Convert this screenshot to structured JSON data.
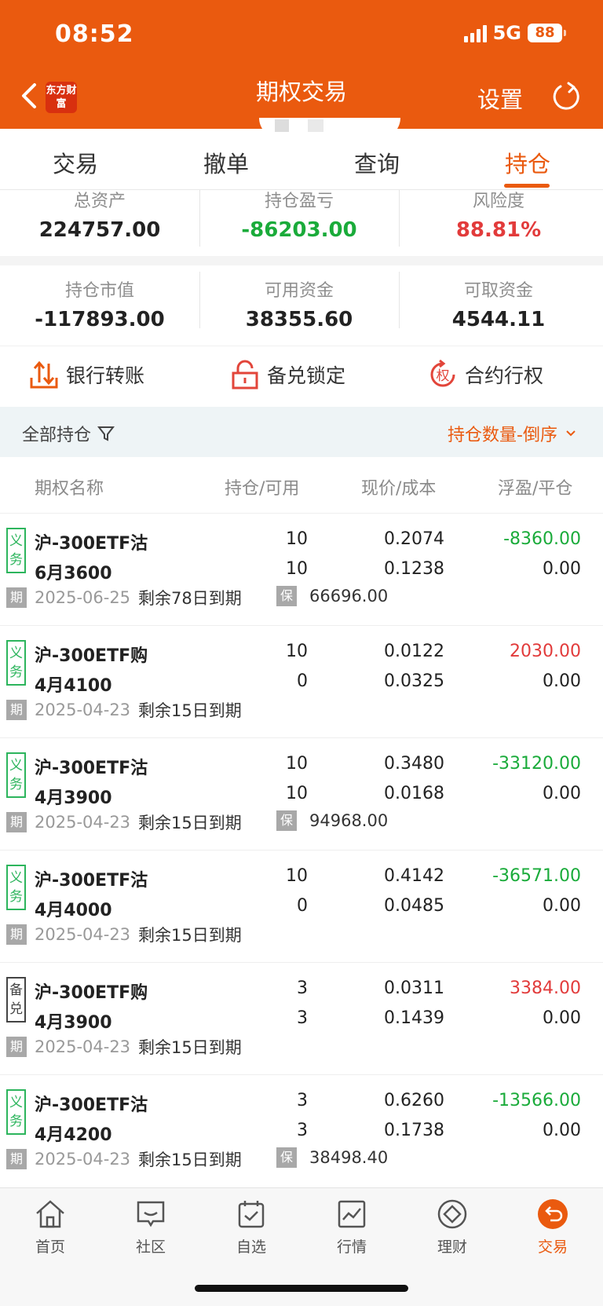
{
  "status_bar": {
    "time": "08:52",
    "network": "5G",
    "battery": "88"
  },
  "header": {
    "title": "期权交易",
    "settings_label": "设置",
    "logo_text": "东方财富"
  },
  "tabs": [
    {
      "label": "交易"
    },
    {
      "label": "撤单"
    },
    {
      "label": "查询"
    },
    {
      "label": "持仓"
    }
  ],
  "summary": {
    "total_assets_label": "总资产",
    "total_assets": "224757.00",
    "position_pl_label": "持仓盈亏",
    "position_pl": "-86203.00",
    "risk_label": "风险度",
    "risk": "88.81%",
    "market_value_label": "持仓市值",
    "market_value": "-117893.00",
    "available_label": "可用资金",
    "available": "38355.60",
    "withdrawable_label": "可取资金",
    "withdrawable": "4544.11"
  },
  "actions": {
    "bank_transfer": "银行转账",
    "cover_lock": "备兑锁定",
    "exercise": "合约行权"
  },
  "filter": {
    "left_label": "全部持仓",
    "sort_label": "持仓数量-倒序"
  },
  "columns": {
    "name": "期权名称",
    "qty": "持仓/可用",
    "price": "现价/成本",
    "pl": "浮盈/平仓"
  },
  "tags": {
    "expiry": "期",
    "margin": "保"
  },
  "positions": [
    {
      "badge": "义务",
      "name1": "沪-300ETF沽",
      "name2": "6月3600",
      "qty": "10",
      "avail": "10",
      "price": "0.2074",
      "cost": "0.1238",
      "pl": "-8360.00",
      "close": "0.00",
      "date": "2025-06-25",
      "remain": "剩余78日到期",
      "margin": "66696.00"
    },
    {
      "badge": "义务",
      "name1": "沪-300ETF购",
      "name2": "4月4100",
      "qty": "10",
      "avail": "0",
      "price": "0.0122",
      "cost": "0.0325",
      "pl": "2030.00",
      "close": "0.00",
      "date": "2025-04-23",
      "remain": "剩余15日到期",
      "margin": ""
    },
    {
      "badge": "义务",
      "name1": "沪-300ETF沽",
      "name2": "4月3900",
      "qty": "10",
      "avail": "10",
      "price": "0.3480",
      "cost": "0.0168",
      "pl": "-33120.00",
      "close": "0.00",
      "date": "2025-04-23",
      "remain": "剩余15日到期",
      "margin": "94968.00"
    },
    {
      "badge": "义务",
      "name1": "沪-300ETF沽",
      "name2": "4月4000",
      "qty": "10",
      "avail": "0",
      "price": "0.4142",
      "cost": "0.0485",
      "pl": "-36571.00",
      "close": "0.00",
      "date": "2025-04-23",
      "remain": "剩余15日到期",
      "margin": ""
    },
    {
      "badge": "备兑",
      "name1": "沪-300ETF购",
      "name2": "4月3900",
      "qty": "3",
      "avail": "3",
      "price": "0.0311",
      "cost": "0.1439",
      "pl": "3384.00",
      "close": "0.00",
      "date": "2025-04-23",
      "remain": "剩余15日到期",
      "margin": ""
    },
    {
      "badge": "义务",
      "name1": "沪-300ETF沽",
      "name2": "4月4200",
      "qty": "3",
      "avail": "3",
      "price": "0.6260",
      "cost": "0.1738",
      "pl": "-13566.00",
      "close": "0.00",
      "date": "2025-04-23",
      "remain": "剩余15日到期",
      "margin": "38498.40"
    }
  ],
  "bottom_nav": [
    {
      "label": "首页",
      "icon": "home-icon"
    },
    {
      "label": "社区",
      "icon": "community-icon"
    },
    {
      "label": "自选",
      "icon": "watchlist-icon"
    },
    {
      "label": "行情",
      "icon": "market-icon"
    },
    {
      "label": "理财",
      "icon": "wealth-icon"
    },
    {
      "label": "交易",
      "icon": "trade-icon"
    }
  ],
  "colors": {
    "brand": "#ea5a0f",
    "gain": "#e23b3b",
    "loss": "#1aab3a"
  }
}
